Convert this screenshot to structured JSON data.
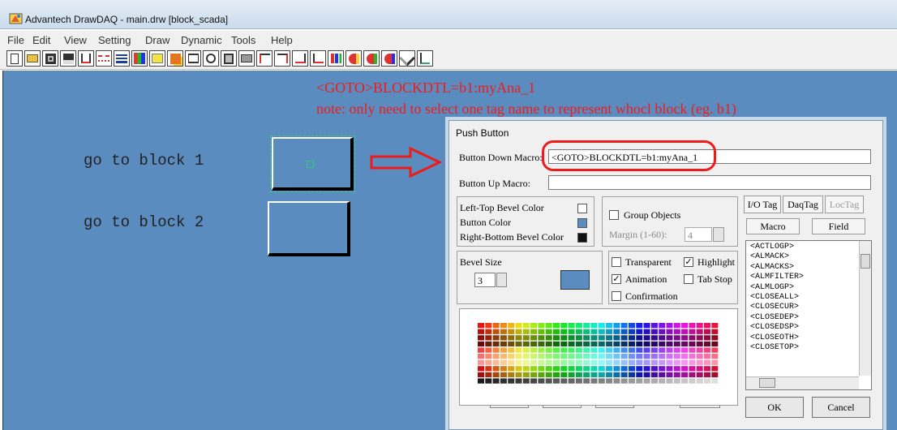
{
  "window": {
    "title": "Advantech DrawDAQ - main.drw [block_scada]",
    "menu": [
      "File",
      "Edit",
      "View",
      "Setting",
      "Draw",
      "Dynamic",
      "Tools",
      "Help"
    ]
  },
  "toolbar": {
    "icons": [
      "new-icon",
      "open-icon",
      "save-icon",
      "save-as-icon",
      "cut-icon",
      "line-style-icon",
      "line-width-icon",
      "fill-color-icon",
      "text-icon",
      "arrange-icon",
      "group-icon",
      "refresh-icon",
      "properties-icon",
      "print-icon",
      "align-left-icon",
      "align-right-icon",
      "align-top-icon",
      "align-bottom-icon",
      "chart-icon",
      "dynamic-1-icon",
      "dynamic-2-icon",
      "dynamic-3-icon",
      "tools-icon",
      "pointer-icon"
    ]
  },
  "annotation": {
    "line1": "<GOTO>BLOCKDTL=b1:myAna_1",
    "line2": "note: only need to select one tag name to represent whocl block (eg. b1)",
    "color": "#ee1b1b"
  },
  "canvas": {
    "background": "#5b8cbf",
    "block1_label": "go to block 1",
    "block2_label": "go to block 2"
  },
  "dialog": {
    "title": "Push Button",
    "button_down_label": "Button Down Macro:",
    "button_down_value": "<GOTO>BLOCKDTL=b1:myAna_1",
    "button_up_label": "Button Up Macro:",
    "button_up_value": "",
    "left_top_bevel_label": "Left-Top Bevel Color",
    "button_color_label": "Button Color",
    "right_bottom_bevel_label": "Right-Bottom Bevel Color",
    "group_objects_label": "Group Objects",
    "margin_label": "Margin (1-60):",
    "margin_value": "4",
    "bevel_size_label": "Bevel Size",
    "bevel_size_value": "3",
    "transparent_label": "Transparent",
    "highlight_label": "Highlight",
    "animation_label": "Animation",
    "tab_stop_label": "Tab Stop",
    "confirmation_label": "Confirmation",
    "tabs": [
      "I/O Tag",
      "DaqTag",
      "LocTag"
    ],
    "subtabs": [
      "Macro",
      "Field"
    ],
    "macros": [
      "<ACTLOGP>",
      "<ALMACK>",
      "<ALMACKS>",
      "<ALMFILTER>",
      "<ALMLOGP>",
      "<CLOSEALL>",
      "<CLOSECUR>",
      "<CLOSEDEP>",
      "<CLOSEDSP>",
      "<CLOSEOTH>",
      "<CLOSETOP>"
    ],
    "ok_label": "OK",
    "cancel_label": "Cancel"
  }
}
